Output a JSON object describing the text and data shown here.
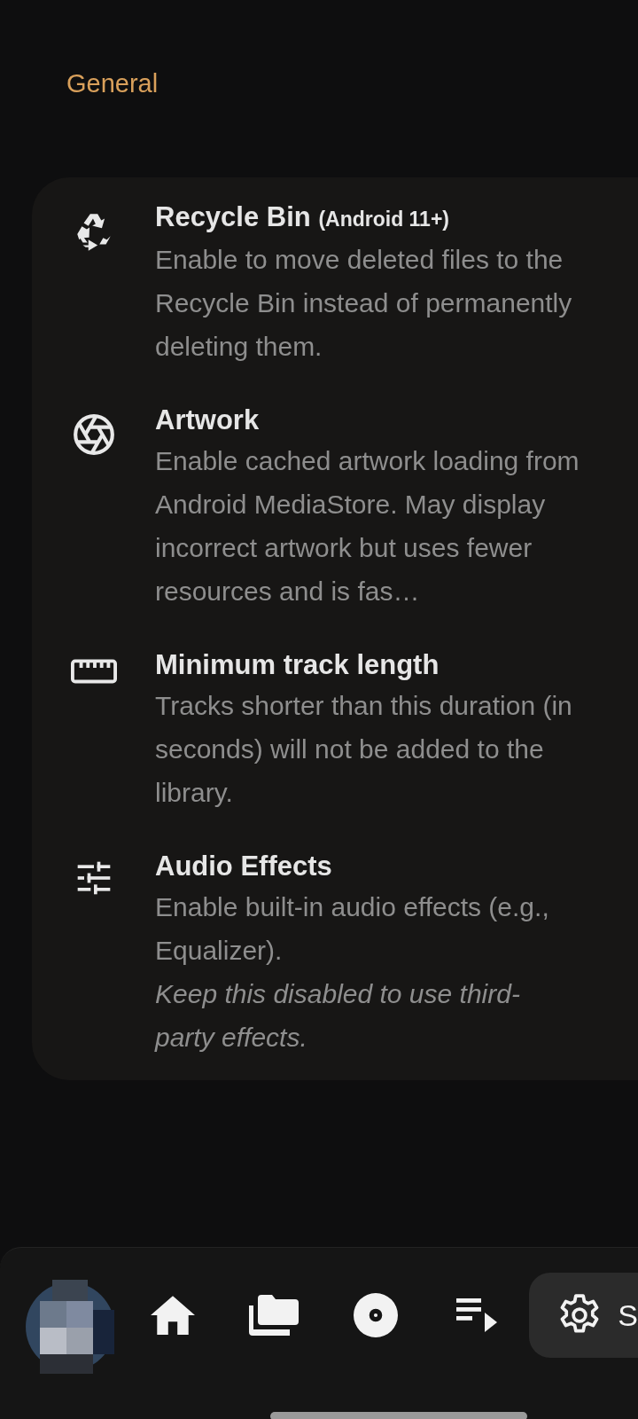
{
  "section_title": "General",
  "settings": [
    {
      "kind": "recycle",
      "title": "Recycle Bin",
      "suffix": "(Android 11+)",
      "description": "Enable to move deleted files to the Recycle Bin instead of permanently deleting them."
    },
    {
      "kind": "aperture",
      "title": "Artwork",
      "description": "Enable cached artwork loading from Android MediaStore. May display incorrect artwork but uses fewer resources and is fas…"
    },
    {
      "kind": "ruler",
      "title": "Minimum track length",
      "description": "Tracks shorter than this duration (in seconds) will not be added to the library."
    },
    {
      "kind": "tune",
      "title": "Audio Effects",
      "description": "Enable built-in audio effects (e.g., Equalizer).",
      "note": "Keep this disabled to use third-party effects."
    }
  ],
  "nav": [
    {
      "kind": "avatar",
      "selected": false
    },
    {
      "kind": "home",
      "selected": false
    },
    {
      "kind": "folders",
      "selected": false
    },
    {
      "kind": "disc",
      "selected": false
    },
    {
      "kind": "queue",
      "selected": false
    },
    {
      "kind": "settings",
      "label": "S",
      "selected": true
    }
  ]
}
